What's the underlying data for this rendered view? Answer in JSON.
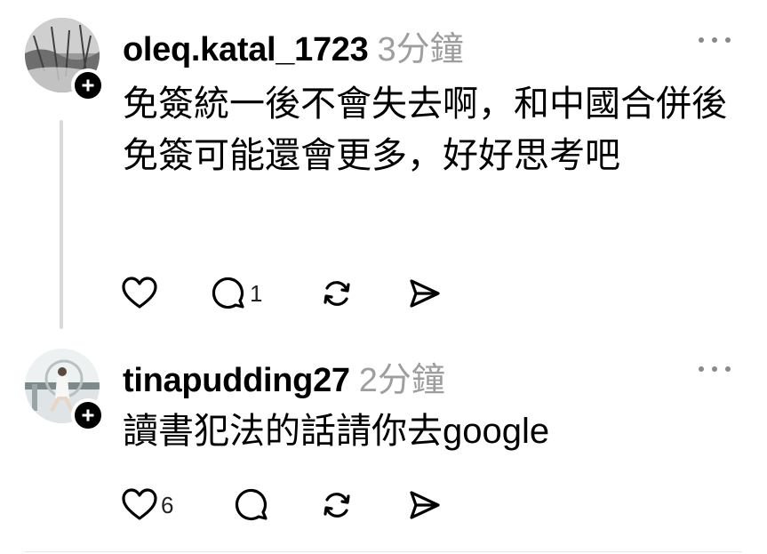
{
  "posts": [
    {
      "username": "oleq.katal_1723",
      "time": "3分鐘",
      "text": "免簽統一後不會失去啊，和中國合併後免簽可能還會更多，好好思考吧",
      "likes": "",
      "replies": "1"
    },
    {
      "username": "tinapudding27",
      "time": "2分鐘",
      "text": "讀書犯法的話請你去google",
      "likes": "6",
      "replies": ""
    }
  ]
}
